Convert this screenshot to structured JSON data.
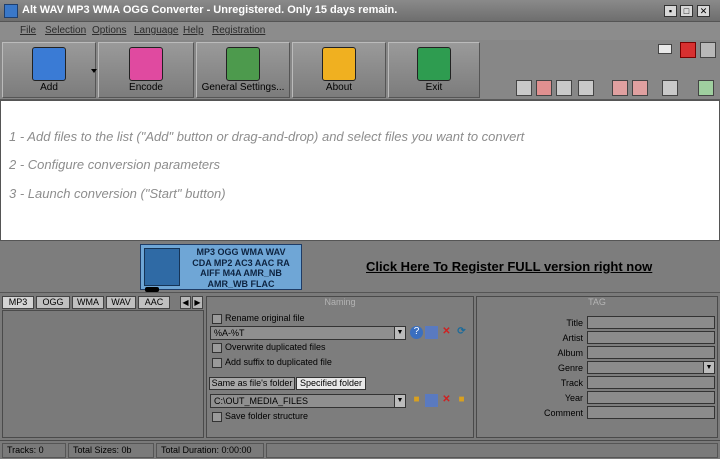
{
  "window": {
    "title": "Alt WAV MP3 WMA OGG Converter - Unregistered. Only 15 days remain.",
    "min_glyph": "▪",
    "max_glyph": "□",
    "close_glyph": "✕"
  },
  "menu": [
    "File",
    "Selection",
    "Options",
    "Language",
    "Help",
    "Registration"
  ],
  "toolbar": {
    "buttons": [
      {
        "label": "Add",
        "color": "#3a7bd5"
      },
      {
        "label": "Encode",
        "color": "#e04aa0"
      },
      {
        "label": "General Settings...",
        "color": "#4d9a4d"
      },
      {
        "label": "About",
        "color": "#f0b020"
      },
      {
        "label": "Exit",
        "color": "#2e9c50"
      }
    ]
  },
  "instructions": [
    "1 - Add files to the list (\"Add\" button or drag-and-drop) and select files you want to convert",
    "2 - Configure conversion parameters",
    "3 - Launch conversion (\"Start\" button)"
  ],
  "banner": {
    "lines": [
      "MP3 OGG WMA WAV",
      "CDA MP2 AC3 AAC RA",
      "AIFF M4A AMR_NB",
      "AMR_WB FLAC"
    ],
    "register_text": "Click Here To Register FULL version right now"
  },
  "format_tabs": [
    "MP3",
    "OGG",
    "WMA",
    "WAV",
    "AAC"
  ],
  "naming": {
    "title": "Naming",
    "rename_label": "Rename original file",
    "pattern_value": "%A-%T",
    "overwrite_label": "Overwrite duplicated files",
    "suffix_label": "Add suffix to duplicated file",
    "tab_same_folder": "Same as file's folder",
    "tab_specified_folder": "Specified folder",
    "folder_value": "C:\\OUT_MEDIA_FILES",
    "save_structure_label": "Save folder structure"
  },
  "tag": {
    "title": "TAG",
    "fields": [
      "Title",
      "Artist",
      "Album",
      "Genre",
      "Track",
      "Year",
      "Comment"
    ]
  },
  "status": {
    "tracks": "Tracks: 0",
    "total_sizes": "Total Sizes: 0b",
    "total_duration": "Total Duration: 0:00:00"
  }
}
